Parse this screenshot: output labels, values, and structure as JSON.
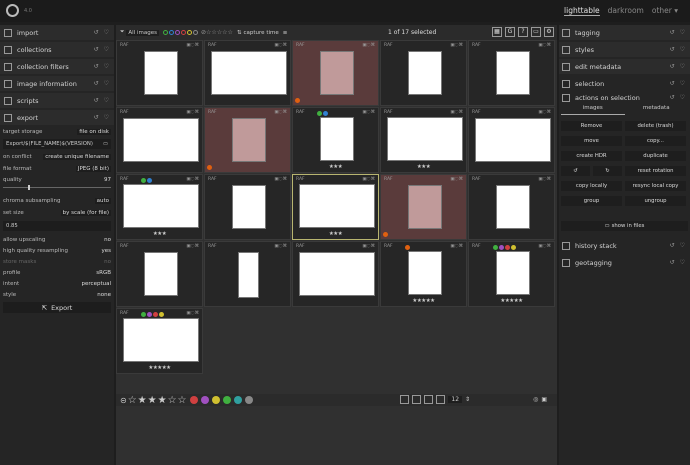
{
  "app": {
    "version": "4.0"
  },
  "views": [
    {
      "label": "lighttable"
    },
    {
      "label": "darkroom"
    },
    {
      "label": "other ▾"
    }
  ],
  "left": {
    "modules": [
      {
        "label": "import",
        "icon": "import-icon"
      },
      {
        "label": "collections",
        "icon": "collections-icon"
      },
      {
        "label": "collection filters",
        "icon": "filter-icon"
      },
      {
        "label": "image information",
        "icon": "info-icon"
      },
      {
        "label": "scripts",
        "icon": "scripts-icon"
      },
      {
        "label": "export",
        "icon": "export-icon"
      }
    ],
    "export": {
      "target_storage_label": "target storage",
      "target_storage_value": "file on disk",
      "path": "Export/$(FILE_NAME)$(VERSION)",
      "on_conflict_label": "on conflict",
      "on_conflict_value": "create unique filename",
      "file_format_label": "file format",
      "file_format_value": "JPEG (8 bit)",
      "quality_label": "quality",
      "quality_value": "97",
      "chroma_label": "chroma subsampling",
      "chroma_value": "auto",
      "set_size_label": "set size",
      "set_size_value": "by scale (for file)",
      "scale_value": "0.85",
      "allow_upscaling_label": "allow upscaling",
      "allow_upscaling_value": "no",
      "hq_label": "high quality resampling",
      "hq_value": "yes",
      "store_masks_label": "store masks",
      "store_masks_value": "no",
      "profile_label": "profile",
      "profile_value": "sRGB",
      "intent_label": "intent",
      "intent_value": "perceptual",
      "style_label": "style",
      "style_value": "none",
      "button_label": "Export"
    }
  },
  "toolbar": {
    "filter_label": "All images",
    "sort_label": "capture time",
    "selection_text": "1 of 17 selected"
  },
  "colors": {
    "red": "#d04040",
    "yellow": "#d0c030",
    "green": "#40b040",
    "blue": "#3080d0",
    "purple": "#a050c0",
    "orange": "#e06010"
  },
  "thumbnails": [
    {
      "tag": "RAF",
      "rating": "",
      "colors": [],
      "orient": "p",
      "selected": false
    },
    {
      "tag": "RAF",
      "rating": "",
      "colors": [],
      "orient": "l",
      "selected": false
    },
    {
      "tag": "RAF",
      "rating": "",
      "colors": [],
      "orient": "p",
      "selected": true,
      "orange": true
    },
    {
      "tag": "RAF",
      "rating": "",
      "colors": [],
      "orient": "p",
      "selected": false
    },
    {
      "tag": "RAF",
      "rating": "",
      "colors": [],
      "orient": "p",
      "selected": false
    },
    {
      "tag": "RAF",
      "rating": "",
      "colors": [],
      "orient": "l",
      "selected": false
    },
    {
      "tag": "RAF",
      "rating": "",
      "colors": [],
      "orient": "p",
      "selected": true,
      "orange": true
    },
    {
      "tag": "RAF",
      "rating": "★★★",
      "colors": [
        "green",
        "blue"
      ],
      "orient": "p",
      "selected": false
    },
    {
      "tag": "RAF",
      "rating": "★★★",
      "colors": [],
      "orient": "l",
      "selected": false
    },
    {
      "tag": "RAF",
      "rating": "",
      "colors": [],
      "orient": "l",
      "selected": false
    },
    {
      "tag": "RAF",
      "rating": "★★★",
      "colors": [
        "green",
        "blue"
      ],
      "orient": "l",
      "selected": false
    },
    {
      "tag": "RAF",
      "rating": "",
      "colors": [],
      "orient": "p",
      "selected": false
    },
    {
      "tag": "RAF",
      "rating": "★★★",
      "colors": [],
      "orient": "l",
      "selected": false,
      "active": true
    },
    {
      "tag": "RAF",
      "rating": "",
      "colors": [],
      "orient": "p",
      "selected": true,
      "orange": true
    },
    {
      "tag": "RAF",
      "rating": "",
      "colors": [],
      "orient": "p",
      "selected": false
    },
    {
      "tag": "RAF",
      "rating": "",
      "colors": [],
      "orient": "p",
      "selected": false
    },
    {
      "tag": "RAF",
      "rating": "",
      "colors": [],
      "orient": "tall",
      "selected": false
    },
    {
      "tag": "RAF",
      "rating": "",
      "colors": [],
      "orient": "l",
      "selected": false
    },
    {
      "tag": "RAF",
      "rating": "★★★★★",
      "colors": [
        "orange"
      ],
      "orient": "p",
      "selected": false
    },
    {
      "tag": "RAF",
      "rating": "★★★★★",
      "colors": [
        "green",
        "purple",
        "red",
        "yellow"
      ],
      "orient": "p",
      "selected": false
    },
    {
      "tag": "RAF",
      "rating": "★★★★★",
      "colors": [
        "green",
        "purple",
        "red",
        "yellow"
      ],
      "orient": "l",
      "selected": false
    }
  ],
  "bottom": {
    "zoom": "12"
  },
  "right": {
    "modules": [
      {
        "label": "tagging",
        "icon": "tag-icon"
      },
      {
        "label": "styles",
        "icon": "styles-icon"
      },
      {
        "label": "edit metadata",
        "icon": "edit-icon"
      },
      {
        "label": "selection",
        "icon": "selection-icon"
      },
      {
        "label": "actions on selection",
        "icon": "actions-icon"
      }
    ],
    "tabs": [
      "images",
      "metadata"
    ],
    "actions": [
      {
        "label": "Remove",
        "icon": "trash-icon"
      },
      {
        "label": "delete (trash)",
        "icon": "delete-icon"
      },
      {
        "label": "move",
        "icon": ""
      },
      {
        "label": "copy...",
        "icon": ""
      },
      {
        "label": "create HDR",
        "icon": ""
      },
      {
        "label": "duplicate",
        "icon": ""
      },
      {
        "label": "↺",
        "icon": "rotate-left-icon"
      },
      {
        "label": "↻",
        "icon": "rotate-right-icon"
      },
      {
        "label": "reset rotation",
        "icon": ""
      },
      {
        "label": "copy locally",
        "icon": ""
      },
      {
        "label": "resync local copy",
        "icon": ""
      },
      {
        "label": "group",
        "icon": "group-icon"
      },
      {
        "label": "ungroup",
        "icon": ""
      }
    ],
    "show_in_files": "show in files",
    "lower_modules": [
      {
        "label": "history stack",
        "icon": "history-icon"
      },
      {
        "label": "geotagging",
        "icon": "map-icon"
      }
    ]
  }
}
